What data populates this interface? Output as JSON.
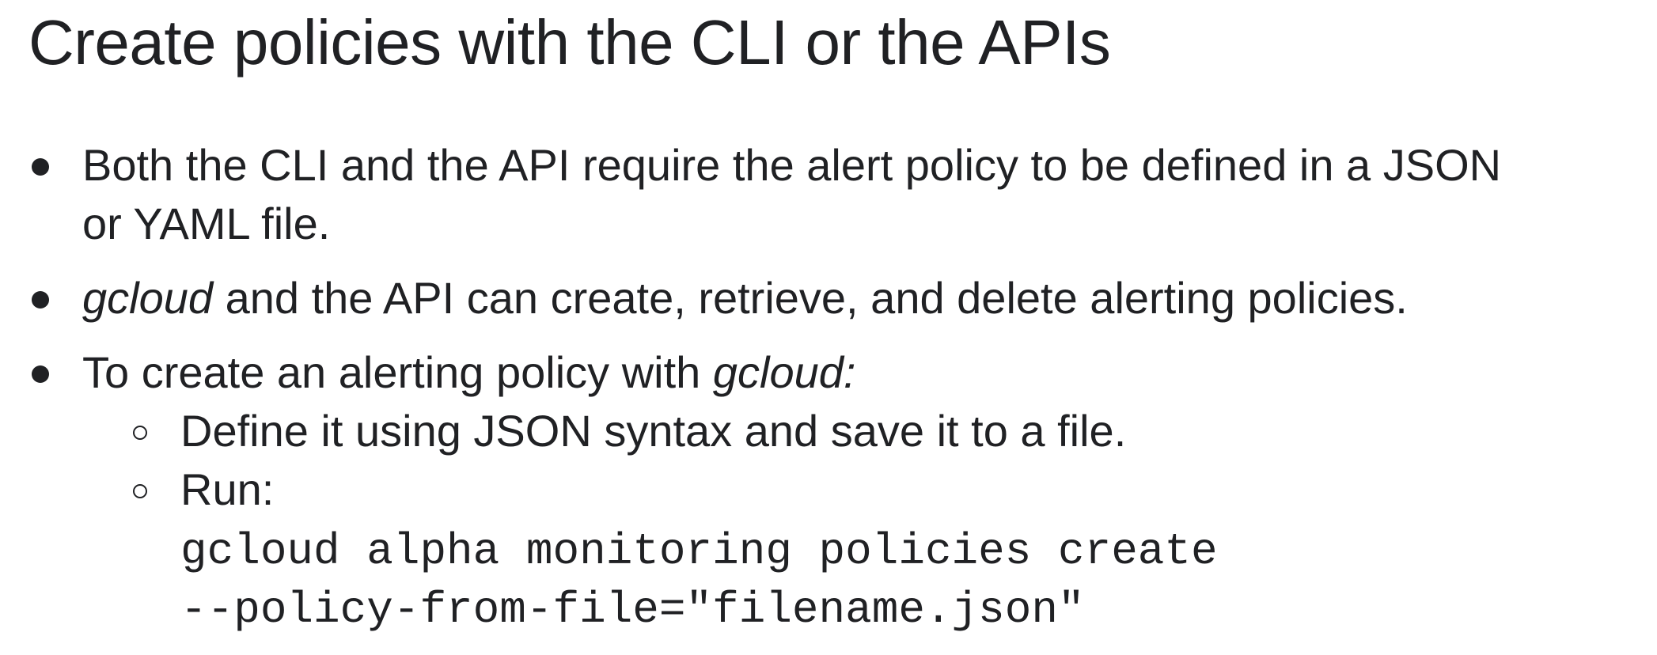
{
  "slide": {
    "title": "Create policies with the CLI or the APIs",
    "bullets": [
      {
        "line1": "Both the CLI and the API require the alert policy to be defined in a JSON",
        "line2": "or YAML file."
      },
      {
        "em": "gcloud",
        "rest": " and the API can create, retrieve, and delete alerting policies."
      },
      {
        "prefix": "To create an alerting policy with ",
        "em": "gcloud:",
        "subitems": [
          {
            "text": "Define it using JSON syntax and save it to a file."
          },
          {
            "text": "Run:"
          }
        ],
        "code": [
          "gcloud alpha monitoring policies create",
          "--policy-from-file=\"filename.json\""
        ]
      }
    ]
  }
}
